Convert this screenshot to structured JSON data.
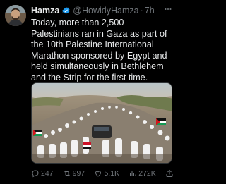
{
  "tweet": {
    "author_name": "Hamza",
    "handle": "@HowidyHamza",
    "separator": "·",
    "time": "7h",
    "text": "Today, more than 2,500 Palestinians ran in Gaza as part of the 10th Palestine International Marathon sponsored by Egypt and held simultaneously in Bethlehem and the Strip for the first time.",
    "media_description": "Crowd of runners in white shirts with Palestinian and Egyptian flags on a dirt road"
  },
  "actions": {
    "replies": "247",
    "retweets": "997",
    "likes": "5.1K",
    "views": "272K"
  },
  "colors": {
    "background": "#000000",
    "text": "#e7e9ea",
    "muted": "#71767b",
    "verified": "#1d9bf0"
  },
  "icons": {
    "verified": "verified-badge-icon",
    "more": "more-dots-icon",
    "reply": "reply-icon",
    "retweet": "retweet-icon",
    "like": "heart-icon",
    "views": "views-chart-icon",
    "share": "share-icon"
  }
}
